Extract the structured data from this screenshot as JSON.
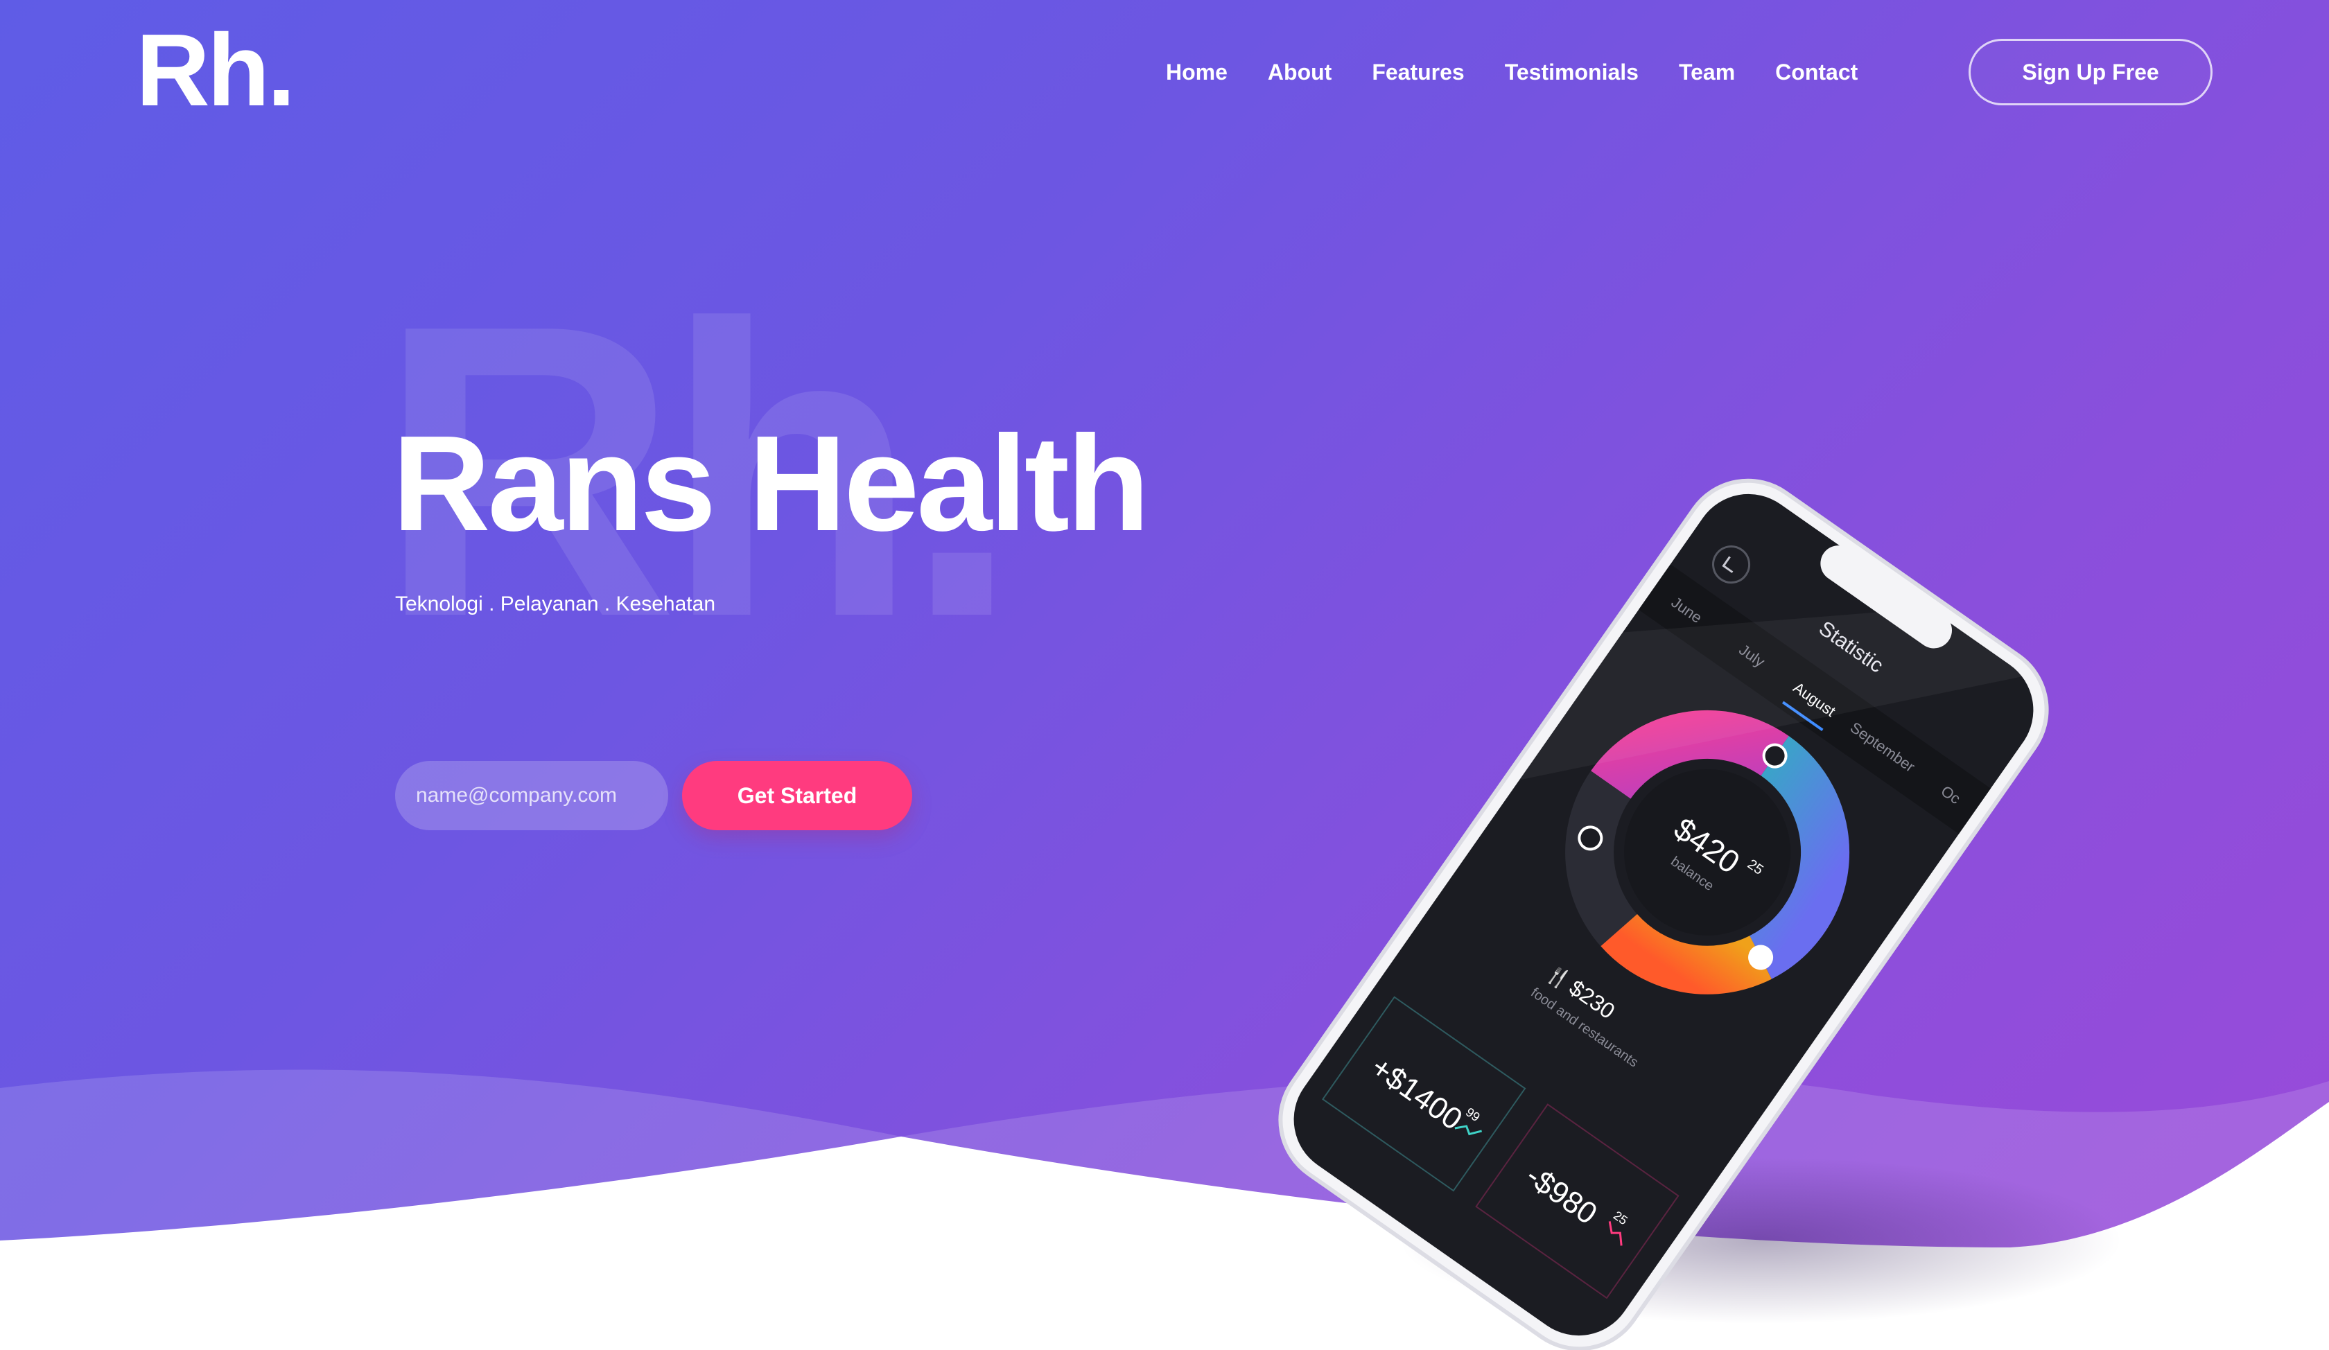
{
  "brand": {
    "logo": "Rh.",
    "watermark": "Rh."
  },
  "nav": {
    "items": [
      {
        "label": "Home"
      },
      {
        "label": "About"
      },
      {
        "label": "Features"
      },
      {
        "label": "Testimonials"
      },
      {
        "label": "Team"
      },
      {
        "label": "Contact"
      }
    ],
    "signup_label": "Sign Up Free"
  },
  "hero": {
    "title": "Rans Health",
    "subtitle": "Teknologi . Pelayanan . Kesehatan",
    "email_placeholder": "name@company.com",
    "cta_label": "Get Started"
  },
  "phone_screen": {
    "title": "Statistic",
    "months": [
      "June",
      "July",
      "August",
      "September",
      "Oc"
    ],
    "active_month": "August",
    "balance": {
      "amount": "$420",
      "cents": "25",
      "label": "balance"
    },
    "food": {
      "amount": "$230",
      "label": "food and restaurants"
    },
    "expense": {
      "amount": "-$980",
      "cents": "25"
    },
    "income": {
      "amount": "+$1400",
      "cents": "99"
    }
  },
  "colors": {
    "accent": "#ff3b7f",
    "gradient_start": "#5f5ce6",
    "gradient_end": "#9a4ad9",
    "screen": "#1b1c22"
  }
}
